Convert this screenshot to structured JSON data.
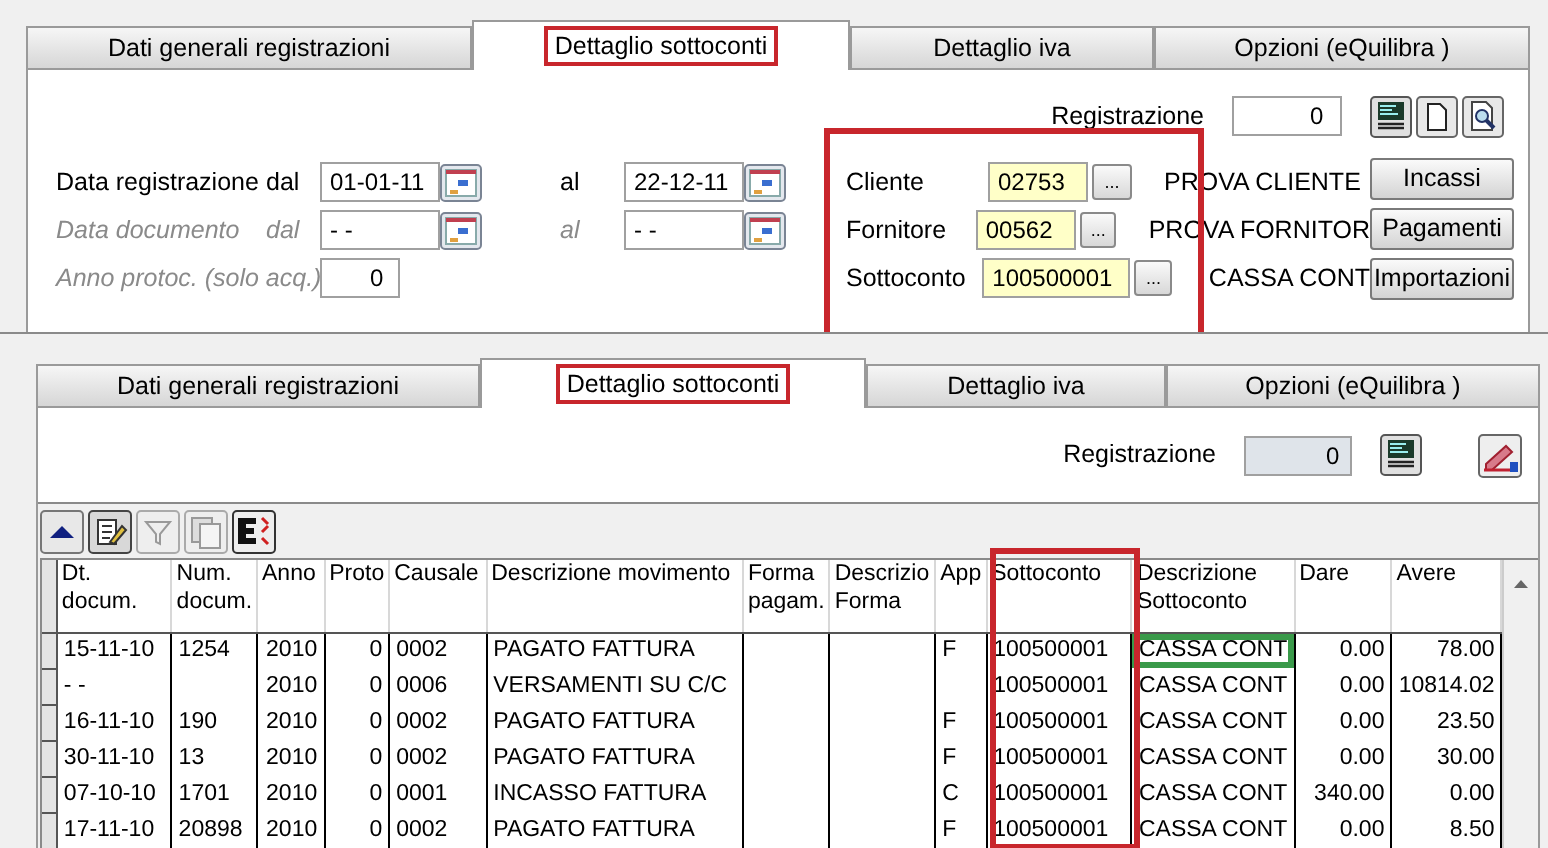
{
  "top": {
    "tabs": [
      {
        "label": "Dati generali registrazioni",
        "selected": false,
        "highlighted": false
      },
      {
        "label": "Dettaglio sottoconti",
        "selected": true,
        "highlighted": true
      },
      {
        "label": "Dettaglio iva",
        "selected": false,
        "highlighted": false
      },
      {
        "label": "Opzioni (eQuilibra )",
        "selected": false,
        "highlighted": false
      }
    ],
    "registrazione": {
      "label": "Registrazione",
      "value": "0",
      "disabled": false
    },
    "filters": [
      {
        "kind": "date_range",
        "label": "Data registrazione",
        "from_label": "dal",
        "from": "01-01-11",
        "to_label": "al",
        "to": "22-12-11",
        "disabled": false
      },
      {
        "kind": "date_range",
        "label": "Data documento",
        "from_label": "dal",
        "from": "- -",
        "to_label": "al",
        "to": "- -",
        "disabled": true
      },
      {
        "kind": "number",
        "label": "Anno protoc. (solo acq.)",
        "value": "0",
        "disabled": true
      }
    ],
    "accounts": {
      "highlighted": true,
      "items": [
        {
          "label": "Cliente",
          "code": "02753",
          "browse": "...",
          "name": "PROVA CLIENTE"
        },
        {
          "label": "Fornitore",
          "code": "00562",
          "browse": "...",
          "name": "PROVA FORNITOR"
        },
        {
          "label": "Sottoconto",
          "code": "100500001",
          "browse": "...",
          "name": "CASSA CONT"
        }
      ]
    },
    "buttons": [
      "Incassi",
      "Pagamenti",
      "Importazioni"
    ]
  },
  "bottom": {
    "tabs": [
      {
        "label": "Dati generali registrazioni",
        "selected": false,
        "highlighted": false
      },
      {
        "label": "Dettaglio sottoconti",
        "selected": true,
        "highlighted": true
      },
      {
        "label": "Dettaglio iva",
        "selected": false,
        "highlighted": false
      },
      {
        "label": "Opzioni (eQuilibra )",
        "selected": false,
        "highlighted": false
      }
    ],
    "registrazione": {
      "label": "Registrazione",
      "value": "0",
      "disabled": true
    },
    "table": {
      "columns": [
        {
          "label": "Dt. docum.",
          "highlighted": false
        },
        {
          "label": "Num. docum.",
          "highlighted": false
        },
        {
          "label": "Anno",
          "highlighted": false
        },
        {
          "label": "Proto",
          "highlighted": false
        },
        {
          "label": "Causale",
          "highlighted": false
        },
        {
          "label": "Descrizione movimento",
          "highlighted": false
        },
        {
          "label": "Forma pagam.",
          "highlighted": false
        },
        {
          "label": "Descrizio Forma",
          "highlighted": false
        },
        {
          "label": "App",
          "highlighted": false
        },
        {
          "label": "Sottoconto",
          "highlighted": true
        },
        {
          "label": "Descrizione Sottoconto",
          "highlighted": false
        },
        {
          "label": "Dare",
          "highlighted": false
        },
        {
          "label": "Avere",
          "highlighted": false
        }
      ],
      "rows": [
        {
          "highlighted": true,
          "cells": [
            "15-11-10",
            "1254",
            "2010",
            "0",
            "0002",
            "PAGATO FATTURA",
            null,
            null,
            "F",
            "100500001",
            "CASSA CONT",
            "0.00",
            "78.00"
          ]
        },
        {
          "highlighted": false,
          "cells": [
            "- -",
            null,
            "2010",
            "0",
            "0006",
            "VERSAMENTI SU C/C",
            null,
            null,
            null,
            "100500001",
            "CASSA CONT",
            "0.00",
            "10814.02"
          ]
        },
        {
          "highlighted": false,
          "cells": [
            "16-11-10",
            "190",
            "2010",
            "0",
            "0002",
            "PAGATO FATTURA",
            null,
            null,
            "F",
            "100500001",
            "CASSA CONT",
            "0.00",
            "23.50"
          ]
        },
        {
          "highlighted": false,
          "cells": [
            "30-11-10",
            "13",
            "2010",
            "0",
            "0002",
            "PAGATO FATTURA",
            null,
            null,
            "F",
            "100500001",
            "CASSA CONT",
            "0.00",
            "30.00"
          ]
        },
        {
          "highlighted": false,
          "cells": [
            "07-10-10",
            "1701",
            "2010",
            "0",
            "0001",
            "INCASSO FATTURA",
            null,
            null,
            "C",
            "100500001",
            "CASSA CONT",
            "340.00",
            "0.00"
          ]
        },
        {
          "highlighted": false,
          "cells": [
            "17-11-10",
            "20898",
            "2010",
            "0",
            "0002",
            "PAGATO FATTURA",
            null,
            null,
            "F",
            "100500001",
            "CASSA CONT",
            "0.00",
            "8.50"
          ]
        }
      ]
    }
  }
}
